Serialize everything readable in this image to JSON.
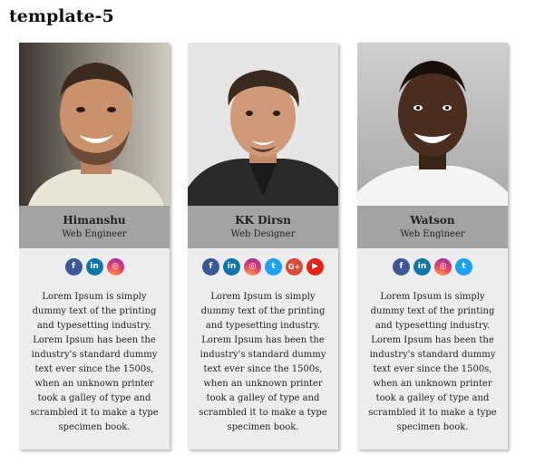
{
  "page": {
    "title": "template-5"
  },
  "cards": [
    {
      "name": "Himanshu",
      "role": "Web Engineer",
      "socials": [
        "facebook",
        "linkedin",
        "instagram"
      ],
      "bio": "Lorem Ipsum is simply dummy text of the printing and typesetting industry. Lorem Ipsum has been the industry's standard dummy text ever since the 1500s, when an unknown printer took a galley of type and scrambled it to make a type specimen book."
    },
    {
      "name": "KK Dirsn",
      "role": "Web Designer",
      "socials": [
        "facebook",
        "linkedin",
        "instagram",
        "twitter",
        "google-plus",
        "youtube"
      ],
      "bio": "Lorem Ipsum is simply dummy text of the printing and typesetting industry. Lorem Ipsum has been the industry's standard dummy text ever since the 1500s, when an unknown printer took a galley of type and scrambled it to make a type specimen book."
    },
    {
      "name": "Watson",
      "role": "Web Engineer",
      "socials": [
        "facebook",
        "linkedin",
        "instagram",
        "twitter"
      ],
      "bio": "Lorem Ipsum is simply dummy text of the printing and typesetting industry. Lorem Ipsum has been the industry's standard dummy text ever since the 1500s, when an unknown printer took a galley of type and scrambled it to make a type specimen book."
    }
  ],
  "colors": {
    "card_bg": "#ededed",
    "name_bar": "#a3a3a3",
    "facebook": "#3b5998",
    "linkedin": "#0e76a8",
    "twitter": "#1da1f2",
    "google_plus": "#dd4b39",
    "youtube": "#e62117"
  }
}
